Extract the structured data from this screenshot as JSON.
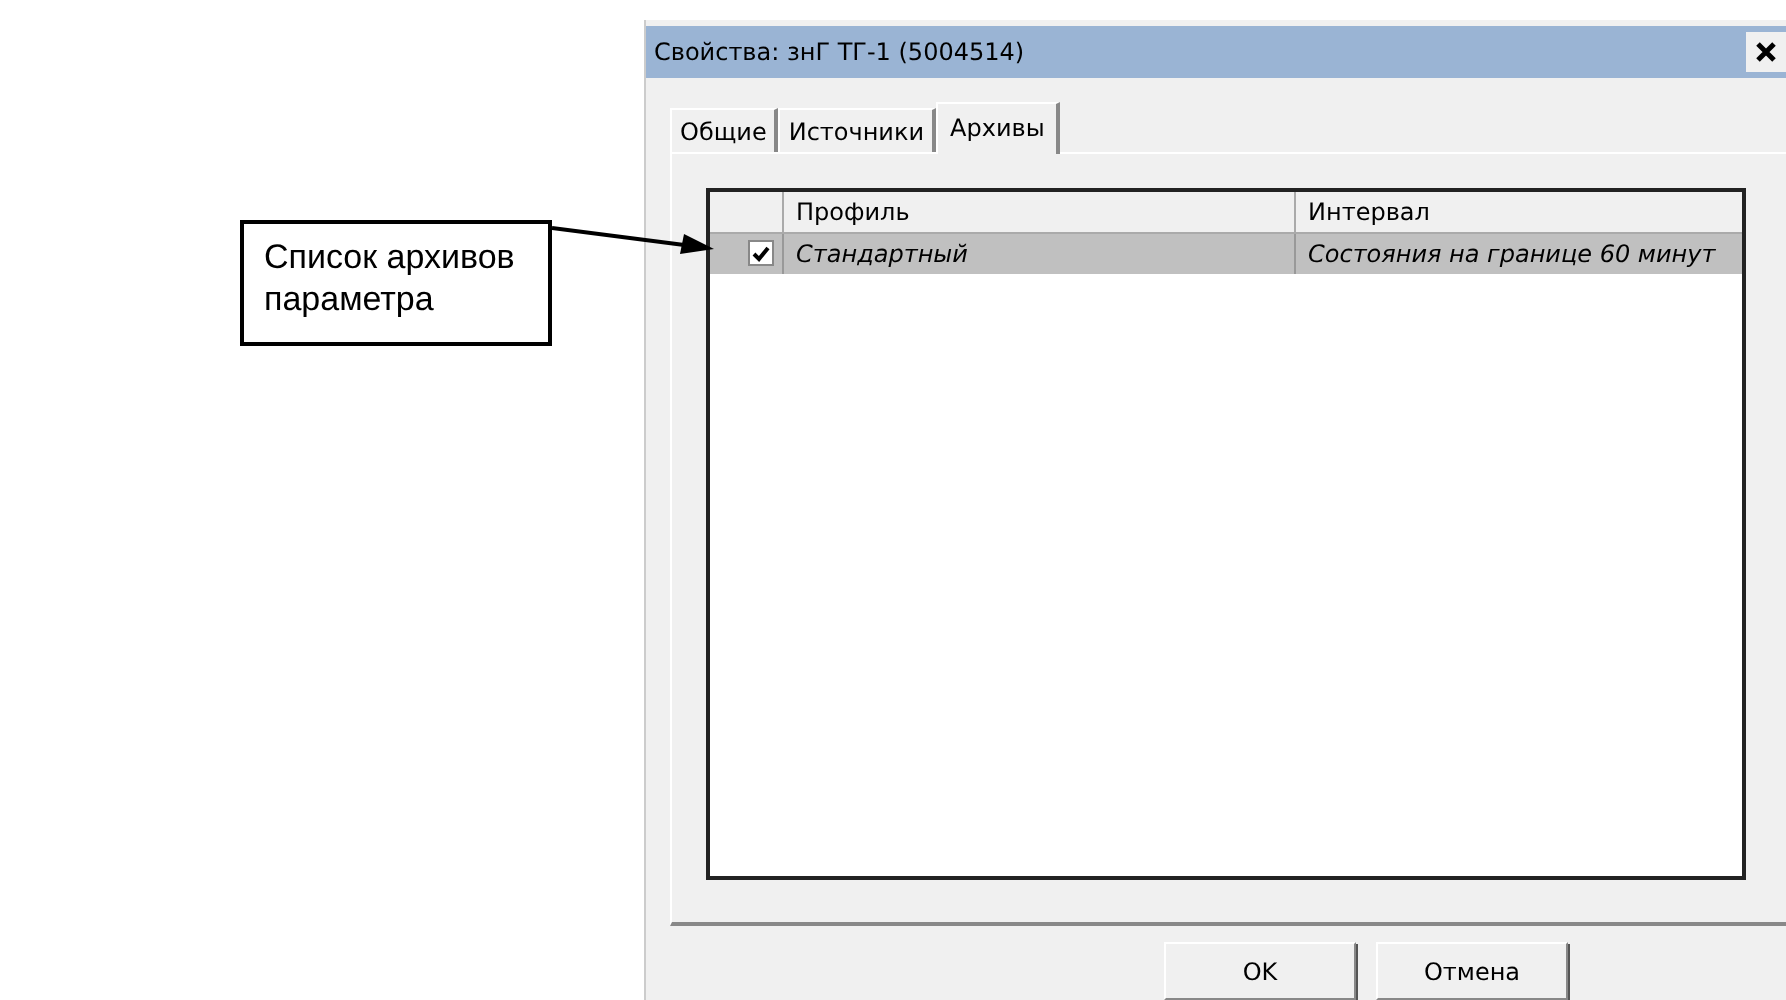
{
  "callout": {
    "text": "Список архивов параметра"
  },
  "dialog": {
    "title": "Свойства: знГ ТГ-1 (5004514)",
    "tabs": [
      {
        "label": "Общие",
        "selected": false
      },
      {
        "label": "Источники",
        "selected": false
      },
      {
        "label": "Архивы",
        "selected": true
      }
    ],
    "table": {
      "columns": [
        "Профиль",
        "Интервал"
      ],
      "rows": [
        {
          "checked": true,
          "selected": true,
          "profile": "Стандартный",
          "interval": "Состояния на границе 60 минут"
        }
      ]
    },
    "buttons": [
      "OK",
      "Отмена"
    ]
  }
}
